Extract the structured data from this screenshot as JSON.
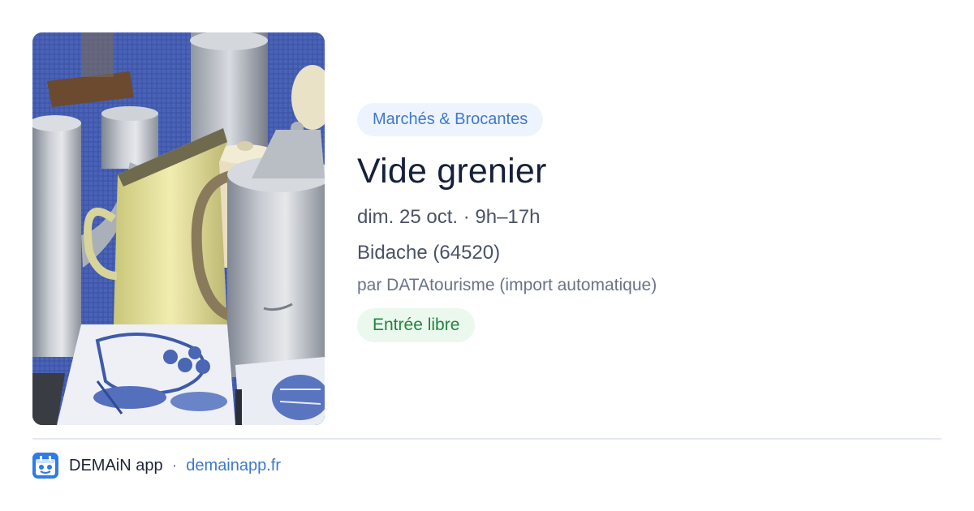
{
  "event": {
    "category": "Marchés & Brocantes",
    "title": "Vide grenier",
    "date_time": "dim. 25 oct. · 9h–17h",
    "location": "Bidache (64520)",
    "organizer": "par DATAtourisme (import automatique)",
    "price": "Entrée libre"
  },
  "photo": {
    "subject": "vintage metal coffee pots, yellow enamel jug and blue painted tiles on a blue tablecloth"
  },
  "footer": {
    "app_icon": "app-logo-icon",
    "app_name": "DEMAiN app",
    "separator": "·",
    "url": "demainapp.fr"
  },
  "colors": {
    "category_pill_bg": "#eef4fd",
    "category_pill_text": "#3e78cf",
    "price_pill_bg": "#ebf8ee",
    "price_pill_text": "#24843e",
    "title_text": "#16203a",
    "link": "#3e78cf",
    "app_logo": "#2f7be8"
  }
}
